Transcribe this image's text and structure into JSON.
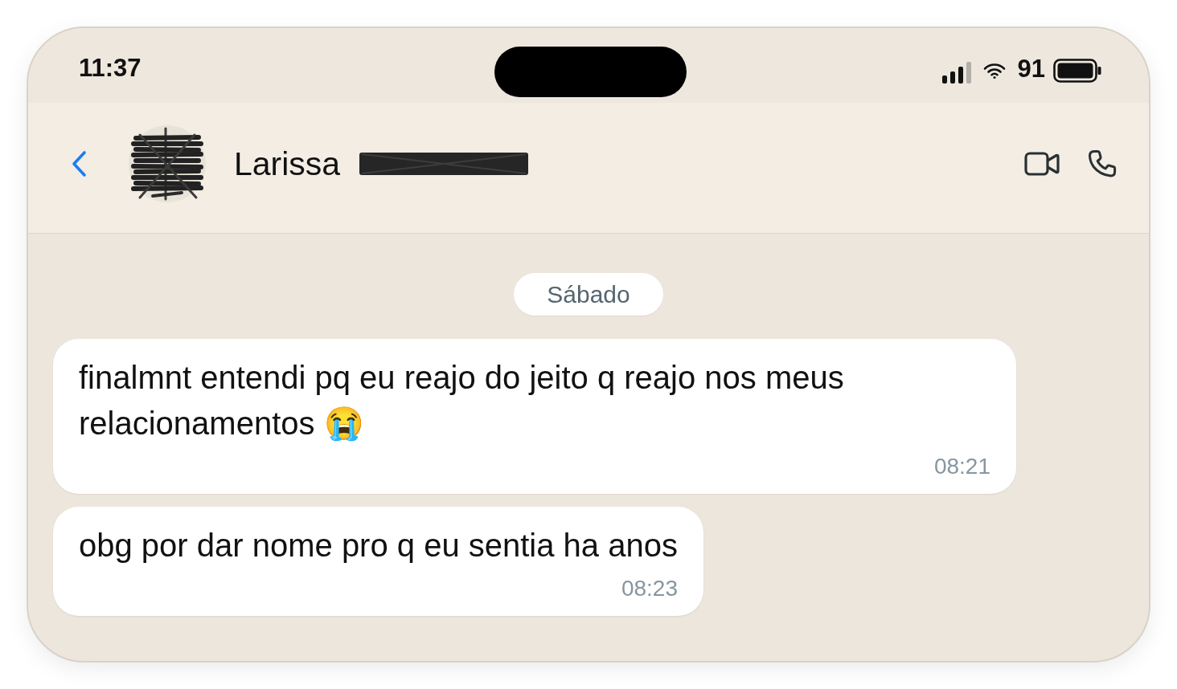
{
  "status_bar": {
    "time": "11:37",
    "battery": "91"
  },
  "header": {
    "contact_name": "Larissa",
    "avatar_scribbled": true,
    "surname_scribbled": true
  },
  "chat": {
    "date_chip": "Sábado",
    "messages": [
      {
        "text": "finalmnt entendi pq eu reajo do jeito q reajo nos meus relacionamentos 😭",
        "time": "08:21"
      },
      {
        "text": "obg por dar nome pro q eu sentia ha anos",
        "time": "08:23"
      }
    ]
  }
}
